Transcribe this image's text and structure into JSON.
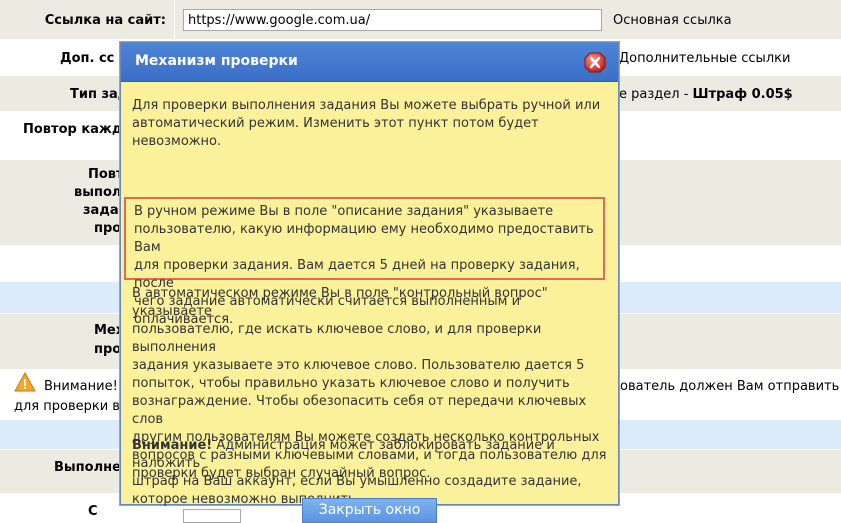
{
  "form": {
    "site_link_label": "Ссылка на сайт:",
    "site_link_value": "https://www.google.com.ua/",
    "site_link_hint": "Основная ссылка",
    "extra_links_label": "Доп. сс",
    "extra_links_hint": "Дополнительные ссылки",
    "type_label": "Тип зад",
    "type_hint_prefix": "е раздел - ",
    "type_hint_penalty": "Штраф 0.05$",
    "repeat_label": "Повтор кажд",
    "check_label_1": "Повт",
    "check_label_2": "выпол",
    "check_label_3": "зада",
    "check_label_4": "про",
    "mech_label_1": "Мех",
    "mech_label_2": "про",
    "warning_label": "Внимание!",
    "warning_tail": "ователь должен Вам отправить",
    "warning_line2": "для проверки в",
    "done_label": "Выполне",
    "bottom_label": "С"
  },
  "modal": {
    "title": "Механизм проверки",
    "para1_l1": "Для проверки выполнения задания Вы можете выбрать ручной или",
    "para1_l2": "автоматический режим. Изменить этот пункт потом будет",
    "para1_l3": "невозможно.",
    "para2_l1": "В ручном режиме Вы в поле \"описание задания\" указываете",
    "para2_l2": "пользователю, какую информацию ему необходимо предоставить Вам",
    "para2_l3": "для проверки задания. Вам дается 5 дней на проверку задания, после",
    "para2_l4": "чего задание автоматически считается выполненным и оплачивается.",
    "para3_l1": "В автоматическом режиме Вы в поле \"контрольный вопрос\" указываете",
    "para3_l2": "пользователю, где искать ключевое слово, и для проверки выполнения",
    "para3_l3": "задания указываете это ключевое слово. Пользователю дается 5",
    "para3_l4": "попыток, чтобы правильно указать ключевое слово и получить",
    "para3_l5": "вознаграждение. Чтобы обезопасить себя от передачи ключевых слов",
    "para3_l6": "другим пользователям Вы можете создать несколько контрольных",
    "para3_l7": "вопросов с разными ключевыми словами, и тогда пользователю для",
    "para3_l8": "проверки будет выбран случайный вопрос.",
    "para4_bold": "Внимание!",
    "para4_l1_rest": " Администрация может заблокировать задание и наложить",
    "para4_l2": "штраф на Ваш аккаунт, если Вы умышленно создадите задание,",
    "para4_l3": "которое невозможно выполнить.",
    "close_button": "Закрыть окно"
  },
  "colors": {
    "modal_bg": "#fcf19b",
    "header_blue": "#3a6fc7",
    "highlight_border": "#e06b52",
    "row_tint": "#ecebe2",
    "row_blue": "#dcebf9"
  }
}
